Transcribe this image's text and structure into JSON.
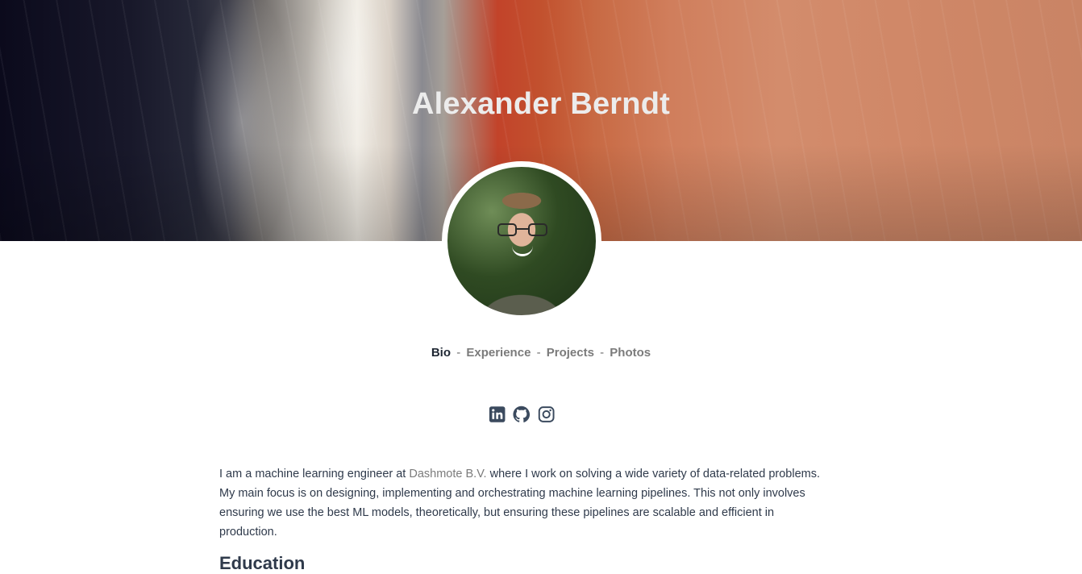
{
  "hero": {
    "title": "Alexander Berndt"
  },
  "nav": {
    "items": [
      {
        "label": "Bio",
        "active": true
      },
      {
        "label": "Experience",
        "active": false
      },
      {
        "label": "Projects",
        "active": false
      },
      {
        "label": "Photos",
        "active": false
      }
    ],
    "separator": "-"
  },
  "social": {
    "icons": [
      "linkedin-icon",
      "github-icon",
      "instagram-icon"
    ],
    "color": "#3b4a5e"
  },
  "bio": {
    "text_before": "I am a machine learning engineer at ",
    "company_link": "Dashmote B.V.",
    "text_after": " where I work on solving a wide variety of data-related problems. My main focus is on designing, implementing and orchestrating machine learning pipelines. This not only involves ensuring we use the best ML models, theoretically, but ensuring these pipelines are scalable and efficient in production."
  },
  "sections": {
    "education_heading": "Education"
  },
  "colors": {
    "text": "#2f3a4b",
    "link": "#7b7b7b",
    "active_nav": "#1f2733"
  }
}
